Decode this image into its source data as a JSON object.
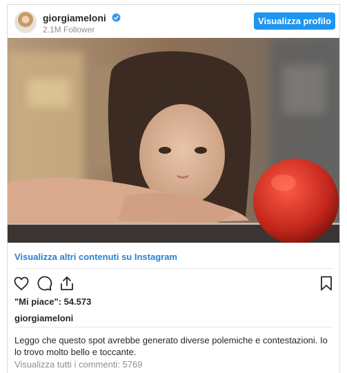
{
  "post": {
    "username": "giorgiameloni",
    "followers": "2.1M Follower",
    "view_profile_label": "Visualizza profilo",
    "image_description_icon": "photo-child-with-peach",
    "more_content_label": "Visualizza altri contenuti su Instagram",
    "likes_text": "\"Mi piace\": 54.573",
    "caption_author": "giorgiameloni",
    "caption_text": "Leggo che questo spot avrebbe generato diverse polemiche e contestazioni. Io lo trovo molto bello e toccante.",
    "comments_label": "Visualizza tutti i commenti: 5769"
  },
  "icons": {
    "verified": "verified-badge-icon",
    "like": "heart-icon",
    "comment": "comment-icon",
    "share": "share-icon",
    "save": "bookmark-icon"
  },
  "colors": {
    "accent": "#1e95ef",
    "link": "#2b7fd0",
    "text": "#262626",
    "muted": "#8e8e8e",
    "border": "#dbdbdb"
  }
}
